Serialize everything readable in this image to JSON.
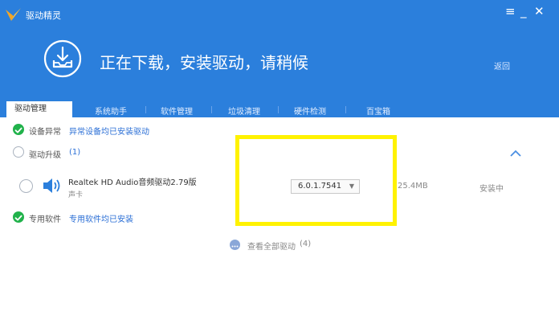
{
  "window": {
    "title": "驱动精灵",
    "menu_icon": "menu-icon",
    "minimize_icon": "minimize-icon",
    "close_icon": "close-icon"
  },
  "status": {
    "icon": "download-tray-icon",
    "title": "正在下载，安装驱动，请稍候",
    "back_label": "返回"
  },
  "tabs": [
    {
      "label": "驱动管理",
      "active": true
    },
    {
      "label": "系统助手",
      "active": false
    },
    {
      "label": "软件管理",
      "active": false
    },
    {
      "label": "垃圾清理",
      "active": false
    },
    {
      "label": "硬件检测",
      "active": false
    },
    {
      "label": "百宝箱",
      "active": false
    }
  ],
  "device_exception": {
    "label": "设备异常",
    "message": "异常设备均已安装驱动"
  },
  "driver_upgrade": {
    "label": "驱动升级",
    "count": "(1)"
  },
  "driver": {
    "name": "Realtek HD Audio音频驱动2.79版",
    "category": "声卡",
    "icon": "speaker-icon",
    "version": "6.0.1.7541",
    "size": "25.4MB",
    "status": "安装中"
  },
  "special_software": {
    "label": "专用软件",
    "message": "专用软件均已安装"
  },
  "view_all": {
    "label": "查看全部驱动",
    "count": "(4)"
  },
  "colors": {
    "header": "#2b7fdc",
    "link": "#2b6fd6",
    "success": "#21b24b",
    "highlight": "#fff200"
  }
}
